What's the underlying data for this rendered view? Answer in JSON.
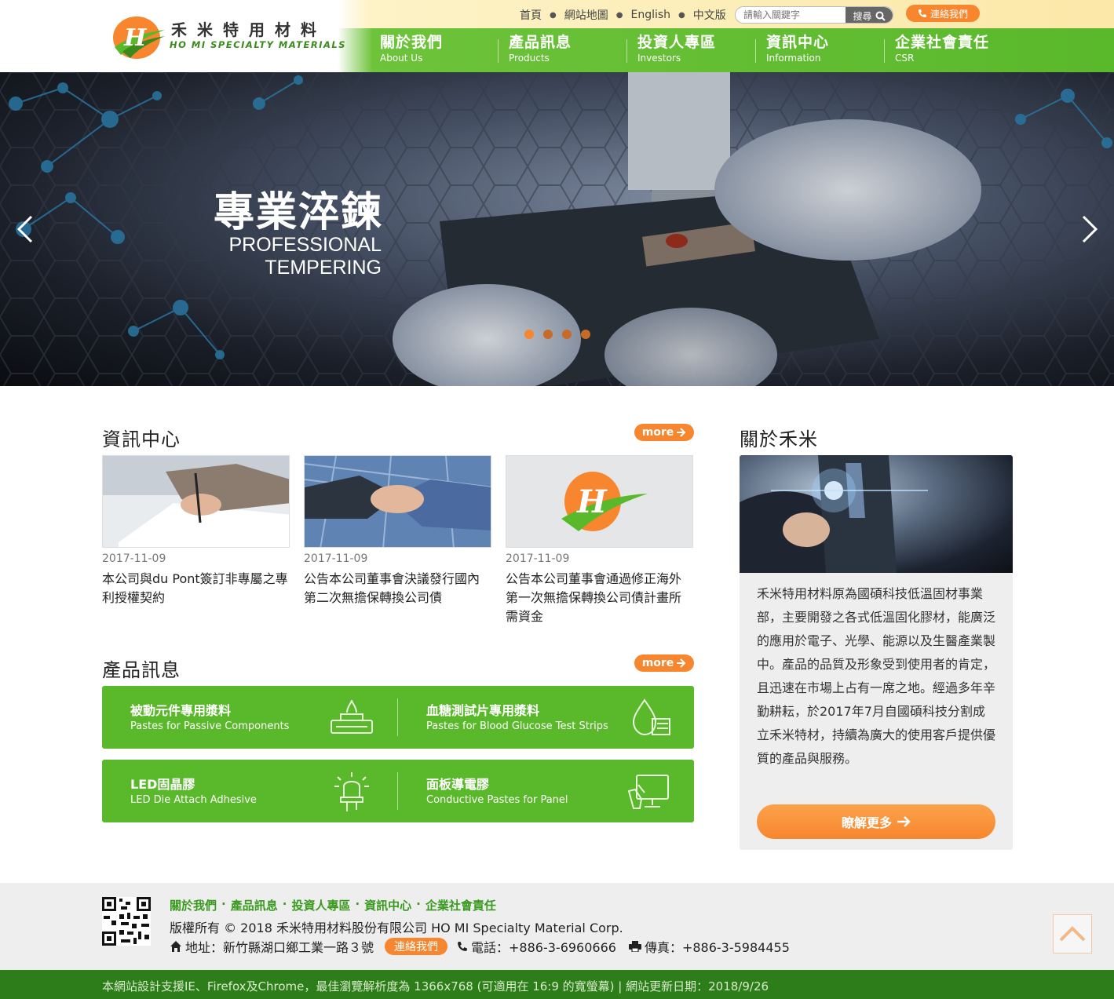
{
  "brand": {
    "name_cn": "禾米特用材料",
    "name_en": "HO MI SPECIALTY MATERIALS",
    "green": "#5ab82b",
    "orange": "#f7862e"
  },
  "toplinks": {
    "home": "首頁",
    "sitemap": "網站地圖",
    "english": "English",
    "chinese": "中文版",
    "search_placeholder": "請輸入關鍵字",
    "search_button": "搜尋",
    "contact": "連絡我們"
  },
  "nav": [
    {
      "cn": "關於我們",
      "en": "About Us"
    },
    {
      "cn": "產品訊息",
      "en": "Products"
    },
    {
      "cn": "投資人專區",
      "en": "Investors"
    },
    {
      "cn": "資訊中心",
      "en": "Information"
    },
    {
      "cn": "企業社會責任",
      "en": "CSR"
    }
  ],
  "hero": {
    "title": "專業淬鍊",
    "subtitle_line1": "PROFESSIONAL",
    "subtitle_line2": "TEMPERING",
    "slide_count": 4,
    "active_slide": 1
  },
  "news": {
    "title": "資訊中心",
    "more": "more",
    "items": [
      {
        "date": "2017-11-09",
        "text": "本公司與du Pont簽訂非專屬之專利授權契約"
      },
      {
        "date": "2017-11-09",
        "text": "公告本公司董事會決議發行國內第二次無擔保轉換公司債"
      },
      {
        "date": "2017-11-09",
        "text": "公告本公司董事會通過修正海外第一次無擔保轉換公司債計畫所需資金"
      }
    ]
  },
  "products": {
    "title": "產品訊息",
    "more": "more",
    "items": [
      {
        "cn": "被動元件專用漿料",
        "en": "Pastes for Passive Components",
        "icon": "passive-component-icon"
      },
      {
        "cn": "血糖測試片專用漿料",
        "en": "Pastes for Blood Glucose Test Strips",
        "icon": "blood-drop-icon"
      },
      {
        "cn": "LED固晶膠",
        "en": "LED Die Attach Adhesive",
        "icon": "led-icon"
      },
      {
        "cn": "面板導電膠",
        "en": "Conductive Pastes for Panel",
        "icon": "monitor-touch-icon"
      }
    ]
  },
  "about": {
    "title": "關於禾米",
    "text": "禾米特用材料原為國碩科技低溫固材事業部，主要開發之各式低溫固化膠材，能廣泛的應用於電子、光學、能源以及生醫產業製中。產品的品質及形象受到使用者的肯定，且迅速在市場上占有一席之地。經過多年辛勤耕耘，於2017年7月自國碩科技分割成立禾米特材，持續為廣大的使用客戶提供優質的產品與服務。",
    "button": "瞭解更多"
  },
  "footer": {
    "links": [
      "關於我們",
      "產品訊息",
      "投資人專區",
      "資訊中心",
      "企業社會責任"
    ],
    "copyright": "版權所有 © 2018 禾米特用材料股份有限公司 HO MI Specialty Material Corp.",
    "address": "地址：新竹縣湖口鄉工業一路３號",
    "contact": "連絡我們",
    "phone": "電話：+886-3-6960666",
    "fax": "傳真：+886-3-5984455",
    "notice": "本網站設計支援IE、Firefox及Chrome，最佳瀏覽解析度為 1366x768 (可適用在 16:9 的寬螢幕) | 網站更新日期：2018/9/26"
  }
}
